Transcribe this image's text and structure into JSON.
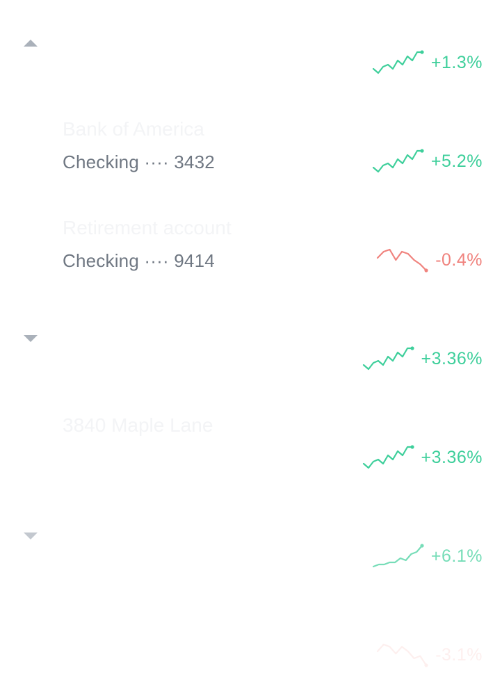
{
  "colors": {
    "positive": "#3ecf9b",
    "negative": "#f0837e",
    "muted_text": "#6f7782",
    "faded_title": "#f3f4f6",
    "toggle": "#aab1ba"
  },
  "icons": {
    "collapse": "triangle-up-icon",
    "expand": "triangle-down-icon"
  },
  "rows": [
    {
      "toggle": "up",
      "title": "",
      "subtitle": "",
      "change": "+1.3%",
      "trend": "up",
      "sparkline": [
        2,
        0,
        3,
        4,
        2,
        6,
        4,
        8,
        6,
        10,
        10
      ],
      "opacity": 1
    },
    {
      "toggle": "",
      "title": "Bank of America",
      "subtitle": "Checking ···· 3432",
      "change": "+5.2%",
      "trend": "up",
      "sparkline": [
        2,
        0,
        3,
        4,
        2,
        6,
        4,
        8,
        6,
        10,
        10
      ],
      "opacity": 1
    },
    {
      "toggle": "",
      "title": "Retirement account",
      "subtitle": "Checking ···· 9414",
      "change": "-0.4%",
      "trend": "down",
      "sparkline": [
        6,
        9,
        10,
        5,
        9,
        8,
        5,
        3,
        0
      ],
      "opacity": 1
    },
    {
      "toggle": "down",
      "title": "",
      "subtitle": "",
      "change": "+3.36%",
      "trend": "up",
      "sparkline": [
        2,
        0,
        3,
        4,
        2,
        6,
        4,
        8,
        6,
        10,
        10
      ],
      "opacity": 1
    },
    {
      "toggle": "",
      "title": "3840 Maple Lane",
      "subtitle": "",
      "change": "+3.36%",
      "trend": "up",
      "sparkline": [
        2,
        0,
        3,
        4,
        2,
        6,
        4,
        8,
        6,
        10,
        10
      ],
      "opacity": 1
    },
    {
      "toggle": "down",
      "title": "",
      "subtitle": "",
      "change": "+6.1%",
      "trend": "up",
      "sparkline": [
        0,
        1,
        1,
        2,
        2,
        4,
        3,
        6,
        7,
        10
      ],
      "opacity": 0.7
    },
    {
      "toggle": "",
      "title": "",
      "subtitle": "",
      "change": "-3.1%",
      "trend": "down",
      "sparkline": [
        6,
        9,
        8,
        5,
        8,
        6,
        3,
        4,
        0
      ],
      "opacity": 0.12
    }
  ]
}
